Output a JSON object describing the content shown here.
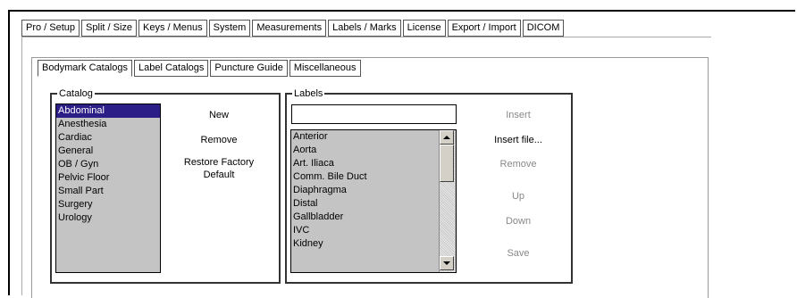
{
  "top_tabs": [
    "Pro / Setup",
    "Split / Size",
    "Keys / Menus",
    "System",
    "Measurements",
    "Labels / Marks",
    "License",
    "Export / Import",
    "DICOM"
  ],
  "sub_tabs": [
    "Bodymark Catalogs",
    "Label Catalogs",
    "Puncture Guide",
    "Miscellaneous"
  ],
  "catalog": {
    "label": "Catalog",
    "items": [
      "Abdominal",
      "Anesthesia",
      "Cardiac",
      "General",
      "OB / Gyn",
      "Pelvic Floor",
      "Small Part",
      "Surgery",
      "Urology"
    ],
    "selected": "Abdominal",
    "buttons": {
      "new": "New",
      "remove": "Remove",
      "restore": "Restore Factory\nDefault"
    }
  },
  "labels": {
    "label": "Labels",
    "input_value": "",
    "items": [
      "Anterior",
      "Aorta",
      "Art. Iliaca",
      "Comm. Bile Duct",
      "Diaphragma",
      "Distal",
      "Gallbladder",
      "IVC",
      "Kidney"
    ],
    "buttons": {
      "insert": "Insert",
      "insert_file": "Insert file...",
      "remove": "Remove",
      "up": "Up",
      "down": "Down",
      "save": "Save"
    }
  },
  "colors": {
    "selected_bg": "#2b1e86",
    "list_bg": "#c4c4c4"
  }
}
